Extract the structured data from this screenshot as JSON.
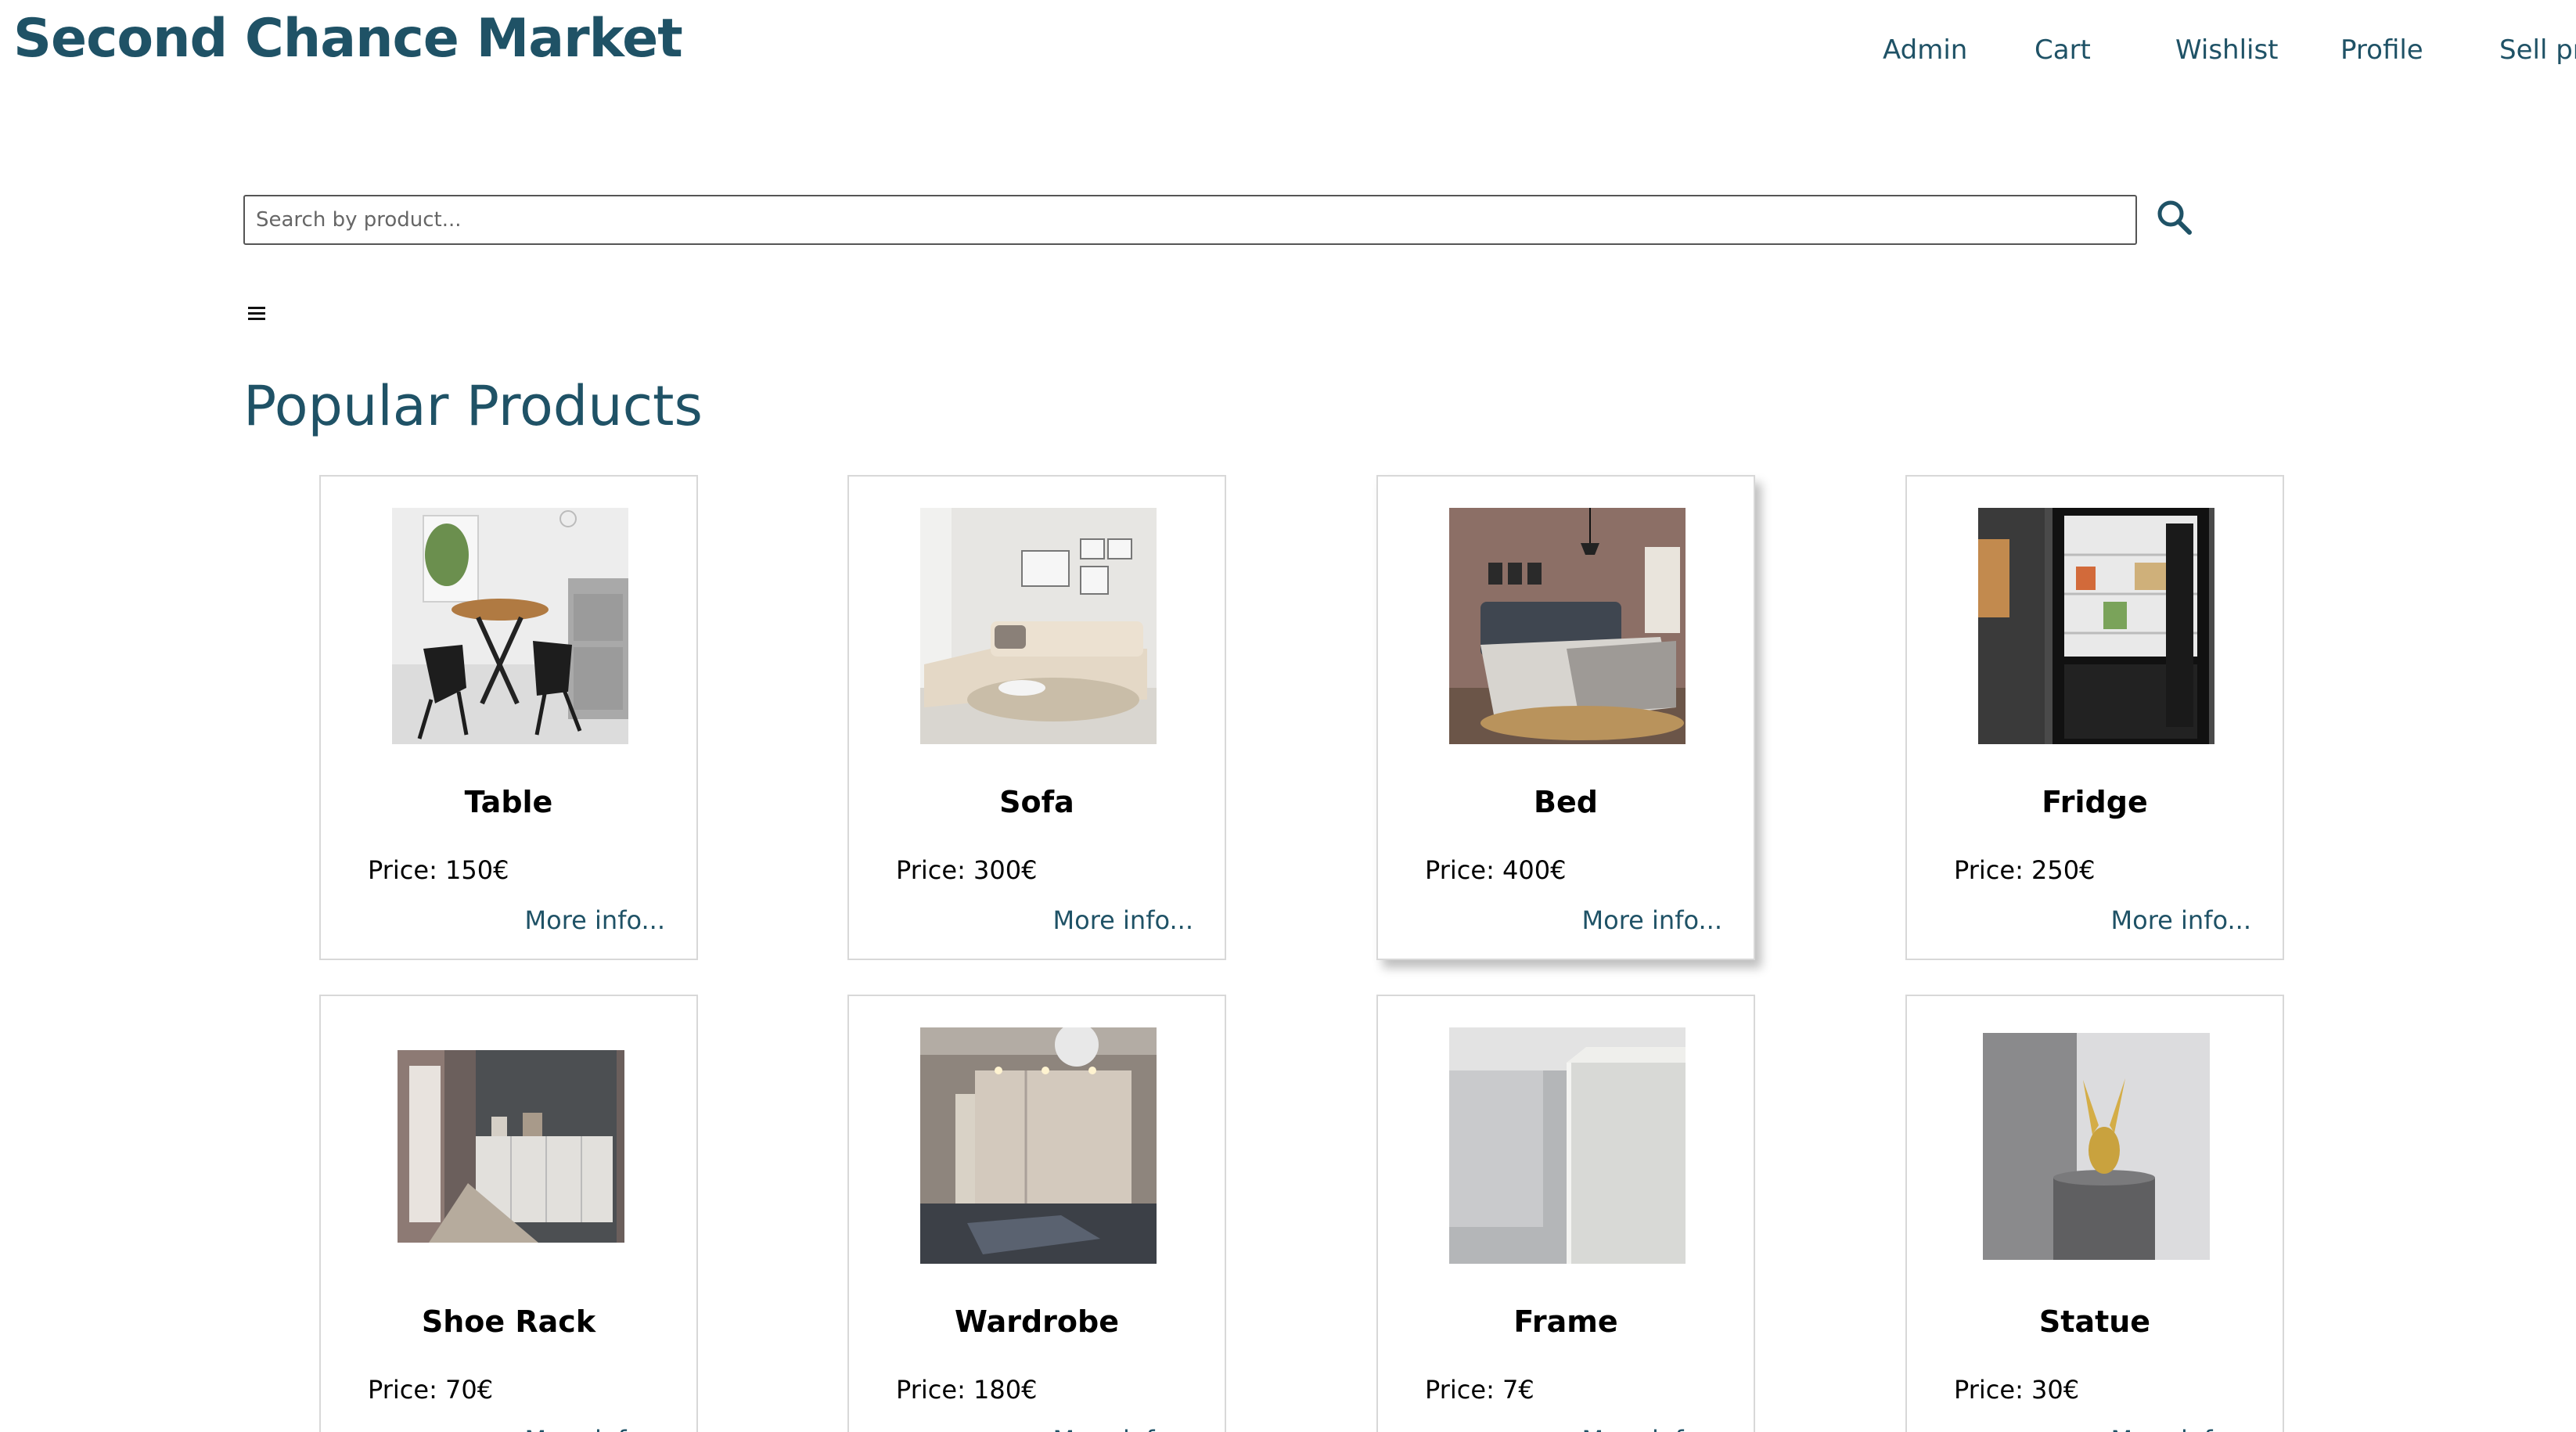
{
  "header": {
    "brand": "Second Chance Market",
    "nav": [
      "Admin",
      "Cart",
      "Wishlist",
      "Profile",
      "Sell product"
    ]
  },
  "search": {
    "placeholder": "Search by product...",
    "value": ""
  },
  "section": {
    "title": "Popular Products"
  },
  "products": [
    {
      "name": "Table",
      "price": "Price: 150€",
      "more": "More info..."
    },
    {
      "name": "Sofa",
      "price": "Price: 300€",
      "more": "More info..."
    },
    {
      "name": "Bed",
      "price": "Price: 400€",
      "more": "More info..."
    },
    {
      "name": "Fridge",
      "price": "Price: 250€",
      "more": "More info..."
    },
    {
      "name": "Shoe Rack",
      "price": "Price: 70€",
      "more": "More info..."
    },
    {
      "name": "Wardrobe",
      "price": "Price: 180€",
      "more": "More info..."
    },
    {
      "name": "Frame",
      "price": "Price: 7€",
      "more": "More info..."
    },
    {
      "name": "Statue",
      "price": "Price: 30€",
      "more": "More info..."
    }
  ],
  "colors": {
    "brand": "#1f5266",
    "card_border": "#d8d8d8",
    "text": "#000000"
  }
}
